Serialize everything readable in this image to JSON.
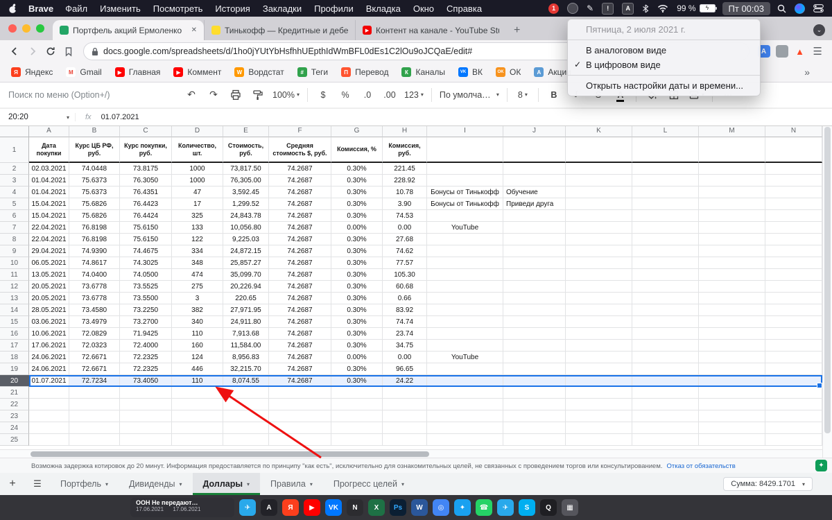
{
  "menubar": {
    "app_name": "Brave",
    "menus": [
      "Файл",
      "Изменить",
      "Посмотреть",
      "История",
      "Закладки",
      "Профили",
      "Вкладка",
      "Окно",
      "Справка"
    ],
    "battery": "99 %",
    "clock": "Пт 00:03"
  },
  "clock_menu": {
    "date": "Пятница, 2 июля 2021 г.",
    "analog": "В аналоговом виде",
    "digital": "В цифровом виде",
    "settings": "Открыть настройки даты и времени..."
  },
  "browser": {
    "tabs": [
      {
        "title": "Портфель акций Ермоленко И",
        "favicon": "sheets",
        "active": true
      },
      {
        "title": "Тинькофф — Кредитные и дебето",
        "favicon": "tinkoff",
        "active": false
      },
      {
        "title": "Контент на канале - YouTube Stud",
        "favicon": "youtube",
        "active": false
      }
    ],
    "url": "docs.google.com/spreadsheets/d/1ho0jYUtYbHsfhhUEpthIdWmBFL0dEs1C2lOu9oJCQaE/edit#",
    "overflow_chevron": "»",
    "bookmarks": [
      {
        "label": "Яндекс",
        "color": "#fc3f1d",
        "glyph": "Я"
      },
      {
        "label": "Gmail",
        "color": "#ffffff",
        "fg": "#ea4335",
        "glyph": "M"
      },
      {
        "label": "Главная",
        "color": "#ff0000",
        "glyph": "▶"
      },
      {
        "label": "Коммент",
        "color": "#ff0000",
        "glyph": "▶"
      },
      {
        "label": "Вордстат",
        "color": "#ff9900",
        "glyph": "W"
      },
      {
        "label": "Теги",
        "color": "#31a24c",
        "glyph": "#"
      },
      {
        "label": "Перевод",
        "color": "#ff5430",
        "glyph": "П"
      },
      {
        "label": "Каналы",
        "color": "#31a24c",
        "glyph": "К"
      },
      {
        "label": "ВК",
        "color": "#0077ff",
        "glyph": "VK"
      },
      {
        "label": "ОК",
        "color": "#f7931e",
        "glyph": "OK"
      },
      {
        "label": "Акции",
        "color": "#5b9bd5",
        "glyph": "А"
      }
    ]
  },
  "sheets_toolbar": {
    "menu_search": "Поиск по меню (Option+/)",
    "undo": "↶",
    "redo": "↷",
    "zoom": "100%",
    "currency": "$",
    "percent": "%",
    "dec_dec": ".0",
    "dec_inc": ".00",
    "more_formats": "123",
    "font_name": "По умолча…",
    "font_size": "8",
    "bold": "B",
    "italic": "I",
    "strike": "S",
    "text_color": "A",
    "more": "⋯"
  },
  "formula_bar": {
    "name_box": "20:20",
    "fx_label": "fx",
    "value": "01.07.2021"
  },
  "sheet": {
    "col_letters": [
      "A",
      "B",
      "C",
      "D",
      "E",
      "F",
      "G",
      "H",
      "I",
      "J",
      "K",
      "L",
      "M",
      "N"
    ],
    "headers": [
      "Дата покупки",
      "Курс ЦБ РФ, руб.",
      "Курс покупки, руб.",
      "Количество, шт.",
      "Стоимость, руб.",
      "Средняя стоимость $, руб.",
      "Комиссия, %",
      "Комиссия, руб."
    ],
    "first_data_row": 2,
    "selected_row": 20,
    "selection_color": "#1a73e8",
    "empty_rows_to": 25,
    "rows": [
      [
        "02.03.2021",
        "74.0448",
        "73.8175",
        "1000",
        "73,817.50",
        "74.2687",
        "0.30%",
        "221.45",
        "",
        ""
      ],
      [
        "01.04.2021",
        "75.6373",
        "76.3050",
        "1000",
        "76,305.00",
        "74.2687",
        "0.30%",
        "228.92",
        "",
        ""
      ],
      [
        "01.04.2021",
        "75.6373",
        "76.4351",
        "47",
        "3,592.45",
        "74.2687",
        "0.30%",
        "10.78",
        "Бонусы от Тинькофф",
        "Обучение"
      ],
      [
        "15.04.2021",
        "75.6826",
        "76.4423",
        "17",
        "1,299.52",
        "74.2687",
        "0.30%",
        "3.90",
        "Бонусы от Тинькофф",
        "Приведи друга"
      ],
      [
        "15.04.2021",
        "75.6826",
        "76.4424",
        "325",
        "24,843.78",
        "74.2687",
        "0.30%",
        "74.53",
        "",
        ""
      ],
      [
        "22.04.2021",
        "76.8198",
        "75.6150",
        "133",
        "10,056.80",
        "74.2687",
        "0.00%",
        "0.00",
        "YouTube",
        ""
      ],
      [
        "22.04.2021",
        "76.8198",
        "75.6150",
        "122",
        "9,225.03",
        "74.2687",
        "0.30%",
        "27.68",
        "",
        ""
      ],
      [
        "29.04.2021",
        "74.9390",
        "74.4675",
        "334",
        "24,872.15",
        "74.2687",
        "0.30%",
        "74.62",
        "",
        ""
      ],
      [
        "06.05.2021",
        "74.8617",
        "74.3025",
        "348",
        "25,857.27",
        "74.2687",
        "0.30%",
        "77.57",
        "",
        ""
      ],
      [
        "13.05.2021",
        "74.0400",
        "74.0500",
        "474",
        "35,099.70",
        "74.2687",
        "0.30%",
        "105.30",
        "",
        ""
      ],
      [
        "20.05.2021",
        "73.6778",
        "73.5525",
        "275",
        "20,226.94",
        "74.2687",
        "0.30%",
        "60.68",
        "",
        ""
      ],
      [
        "20.05.2021",
        "73.6778",
        "73.5500",
        "3",
        "220.65",
        "74.2687",
        "0.30%",
        "0.66",
        "",
        ""
      ],
      [
        "28.05.2021",
        "73.4580",
        "73.2250",
        "382",
        "27,971.95",
        "74.2687",
        "0.30%",
        "83.92",
        "",
        ""
      ],
      [
        "03.06.2021",
        "73.4979",
        "73.2700",
        "340",
        "24,911.80",
        "74.2687",
        "0.30%",
        "74.74",
        "",
        ""
      ],
      [
        "10.06.2021",
        "72.0829",
        "71.9425",
        "110",
        "7,913.68",
        "74.2687",
        "0.30%",
        "23.74",
        "",
        ""
      ],
      [
        "17.06.2021",
        "72.0323",
        "72.4000",
        "160",
        "11,584.00",
        "74.2687",
        "0.30%",
        "34.75",
        "",
        ""
      ],
      [
        "24.06.2021",
        "72.6671",
        "72.2325",
        "124",
        "8,956.83",
        "74.2687",
        "0.00%",
        "0.00",
        "YouTube",
        ""
      ],
      [
        "24.06.2021",
        "72.6671",
        "72.2325",
        "446",
        "32,215.70",
        "74.2687",
        "0.30%",
        "96.65",
        "",
        ""
      ],
      [
        "01.07.2021",
        "72.7234",
        "73.4050",
        "110",
        "8,074.55",
        "74.2687",
        "0.30%",
        "24.22",
        "",
        ""
      ]
    ]
  },
  "disclaimer": {
    "text": "Возможна задержка котировок до 20 минут. Информация предоставляется по принципу \"как есть\", исключительно для ознакомительных целей, не связанных с проведением торгов или консультированием.",
    "link": "Отказ от обязательств"
  },
  "sheetbar": {
    "tabs": [
      {
        "label": "Портфель",
        "active": false
      },
      {
        "label": "Дивиденды",
        "active": false
      },
      {
        "label": "Доллары",
        "active": true
      },
      {
        "label": "Правила",
        "active": false
      },
      {
        "label": "Прогресс целей",
        "active": false
      }
    ],
    "sum_label": "Сумма: 8429.1701"
  },
  "dock": {
    "notification": {
      "title": "ООН Не передают…",
      "subtitle": "17.06.2021      17.06.2021"
    },
    "apps": [
      {
        "name": "telegram",
        "color": "#29a9eb",
        "glyph": "✈"
      },
      {
        "name": "app-store",
        "color": "#222228",
        "glyph": "A"
      },
      {
        "name": "yandex",
        "color": "#fc3f1d",
        "glyph": "Я"
      },
      {
        "name": "youtube",
        "color": "#ff0000",
        "glyph": "▶"
      },
      {
        "name": "vk",
        "color": "#0077ff",
        "glyph": "VK"
      },
      {
        "name": "notes",
        "color": "#2c2c30",
        "glyph": "N"
      },
      {
        "name": "excel",
        "color": "#1e7145",
        "glyph": "X"
      },
      {
        "name": "photoshop",
        "color": "#0b1f33",
        "fg": "#31a8ff",
        "glyph": "Ps"
      },
      {
        "name": "word",
        "color": "#2b579a",
        "glyph": "W"
      },
      {
        "name": "chrome",
        "color": "#4285f4",
        "glyph": "◎"
      },
      {
        "name": "safari",
        "color": "#19a1f0",
        "glyph": "✦"
      },
      {
        "name": "whatsapp",
        "color": "#25d366",
        "glyph": "☎"
      },
      {
        "name": "telegram-2",
        "color": "#29a9eb",
        "glyph": "✈"
      },
      {
        "name": "skype",
        "color": "#00aff0",
        "glyph": "S"
      },
      {
        "name": "quicktime",
        "color": "#1f1f23",
        "glyph": "Q"
      },
      {
        "name": "launchpad",
        "color": "#55555c",
        "glyph": "▦"
      }
    ]
  },
  "icons": {
    "close": "✕",
    "plus": "+",
    "caret": "▾",
    "check": "✓",
    "menu": "☰",
    "star": "✦",
    "bolt": "ϟ",
    "pen": "✎",
    "warning": "!",
    "input_source": "A",
    "burger": "☰",
    "rewards_badge": "1",
    "tab_search": "⌄",
    "translate": "A",
    "rewards_triangle": "▲"
  }
}
